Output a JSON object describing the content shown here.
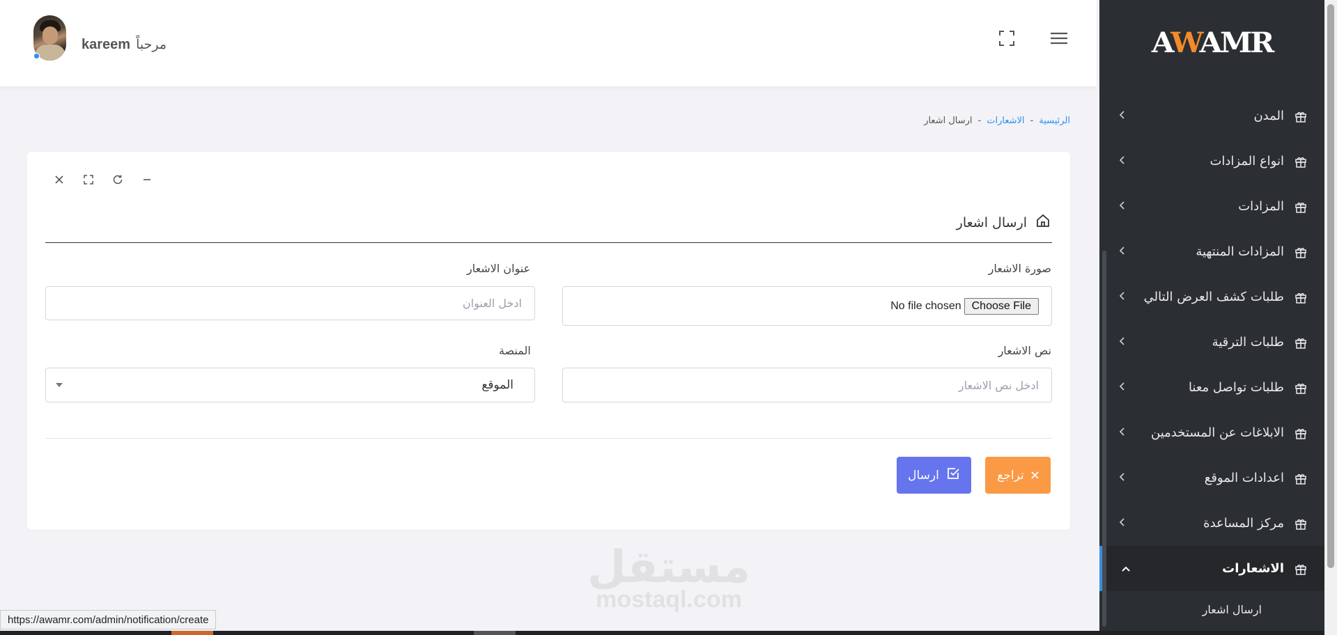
{
  "header": {
    "greeting": "مرحباً",
    "user_name": "kareem"
  },
  "sidebar": {
    "logo_text_a": "A",
    "logo_text_b": "W",
    "logo_text_c": "AMR",
    "items": [
      {
        "label": "المدن"
      },
      {
        "label": "انواع المزادات"
      },
      {
        "label": "المزادات"
      },
      {
        "label": "المزادات المنتهية"
      },
      {
        "label": "طلبات كشف العرض التالي"
      },
      {
        "label": "طلبات الترقية"
      },
      {
        "label": "طلبات تواصل معنا"
      },
      {
        "label": "الابلاغات عن المستخدمين"
      },
      {
        "label": "اعدادات الموقع"
      },
      {
        "label": "مركز المساعدة"
      },
      {
        "label": "الاشعارات"
      }
    ],
    "submenu_item": "ارسال اشعار"
  },
  "breadcrumb": {
    "home": "الرئيسية",
    "section": "الاشعارات",
    "current": "ارسال اشعار",
    "separator": "-"
  },
  "form": {
    "title": "ارسال اشعار",
    "image_label": "صورة الاشعار",
    "file_button": "Choose File",
    "file_status": "No file chosen",
    "title_label": "عنوان الاشعار",
    "title_placeholder": "ادخل العنوان",
    "body_label": "نص الاشعار",
    "body_placeholder": "ادخل نص الاشعار",
    "platform_label": "المنصة",
    "platform_selected": "الموقع",
    "cancel_label": "تراجع",
    "submit_label": "ارسال"
  },
  "watermark": {
    "arabic": "مستقل",
    "latin": "mostaql.com"
  },
  "status_url": "https://awamr.com/admin/notification/create",
  "colors": {
    "sidebar_bg": "#2b2e33",
    "accent_blue": "#2e8ff0",
    "cancel_orange": "#fb9a45",
    "submit_purple": "#6674ee"
  }
}
